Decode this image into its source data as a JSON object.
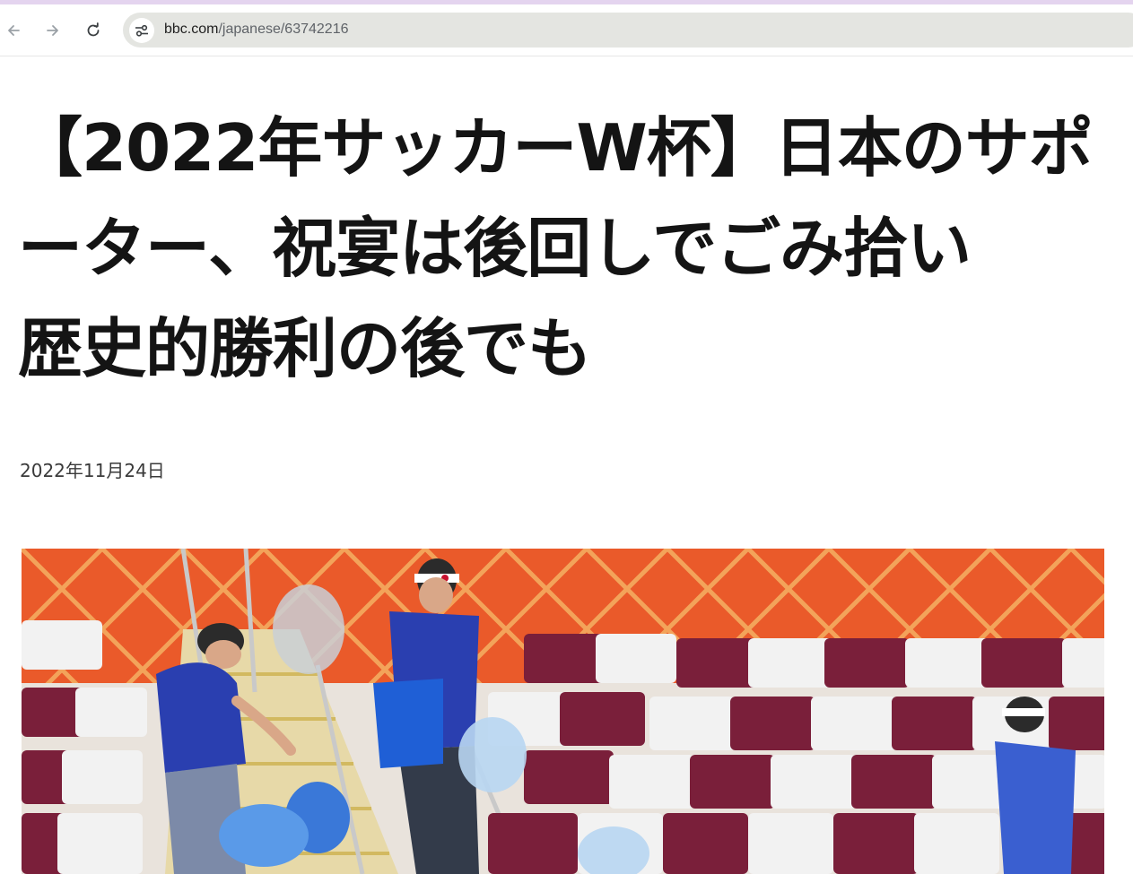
{
  "browser": {
    "back_icon": "arrow-left-icon",
    "forward_icon": "arrow-right-icon",
    "reload_icon": "reload-icon",
    "site_info_icon": "tune-icon",
    "url_domain": "bbc.com",
    "url_path": "/japanese/63742216"
  },
  "article": {
    "headline": "【2022年サッカーW杯】日本のサポーター、祝宴は後回しでごみ拾い　歴史的勝利の後でも",
    "date": "2022年11月24日"
  },
  "colors": {
    "accent_bar": "#e4d4ef",
    "omnibox_bg": "#e4e5e1",
    "headline_text": "#141414",
    "stadium_wall": "#ea5a2a",
    "seat_maroon": "#7a1f3a",
    "seat_white": "#f2f2f2",
    "jersey_blue": "#2a3fb0"
  }
}
